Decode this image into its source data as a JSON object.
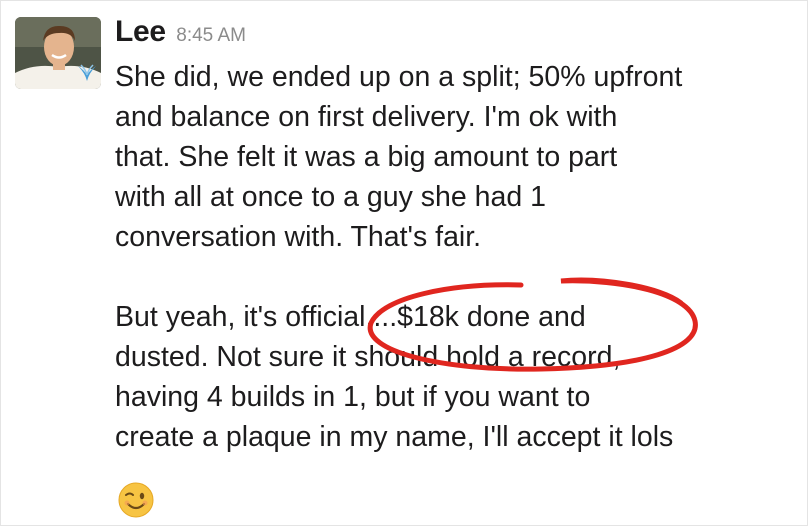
{
  "message": {
    "author": "Lee",
    "timestamp": "8:45 AM",
    "avatar_icon": "user-avatar",
    "badge_icon": "bird-badge-icon",
    "paragraph1": [
      "She did, we ended up on a split; 50% upfront",
      "and balance on first delivery. I'm ok with",
      "that. She felt it was a big amount to part",
      "with all at once to a guy she had 1",
      "conversation with. That's fair."
    ],
    "paragraph2": [
      "But yeah, it's official....$18k done and",
      "dusted. Not sure it should hold a record,",
      "having 4 builds in 1, but if you want to",
      "create a plaque in my name, I'll accept it lols"
    ],
    "emoji": "winking-face-emoji"
  },
  "colors": {
    "text": "#1d1c1d",
    "timestamp": "#8b8b8b",
    "annotation_circle": "#e0261f",
    "badge": "#4a9fd8"
  }
}
